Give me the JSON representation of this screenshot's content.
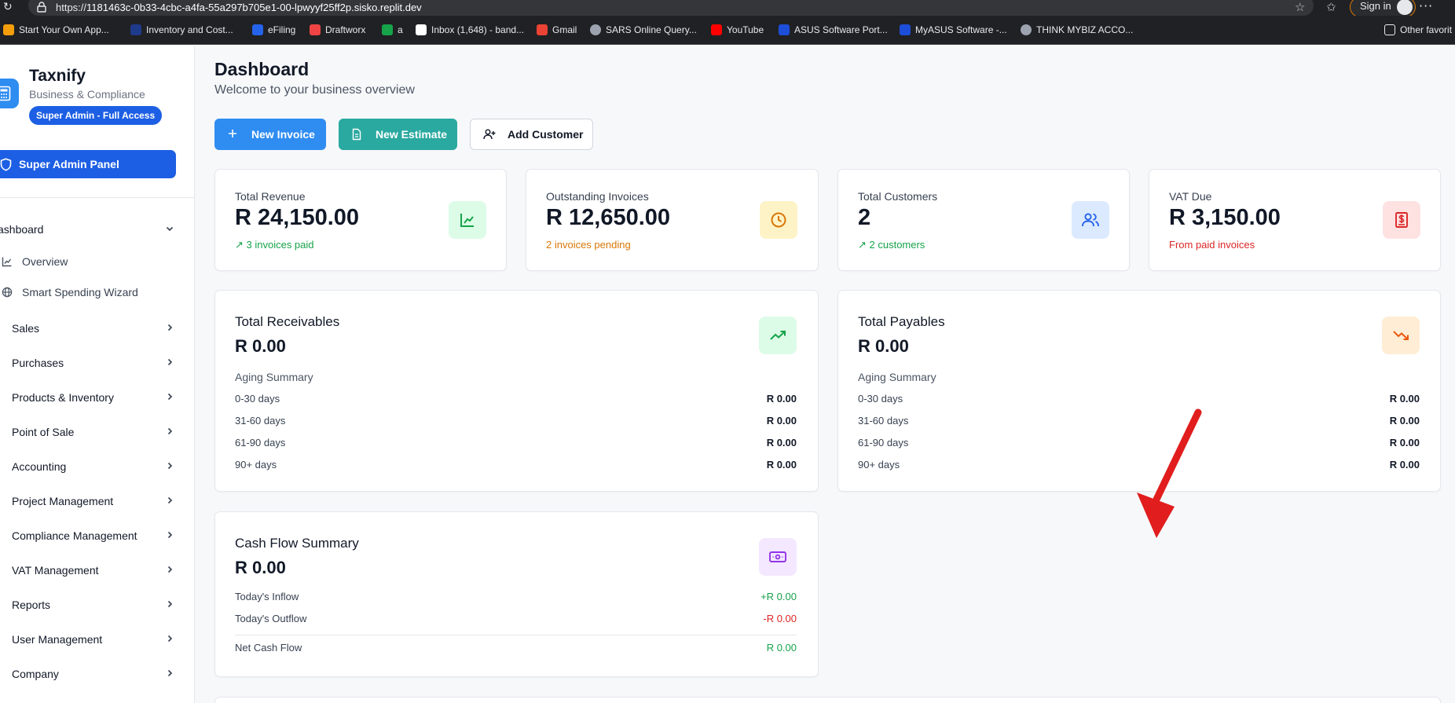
{
  "browser": {
    "url_prefix": "https://",
    "url_host": "1181463c-0b33-4cbc-a4fa-55a297b705e1-00-lpwyyf25ff2p.sisko.replit.dev",
    "signin_label": "Sign in",
    "bookmarks": [
      {
        "label": "Start Your Own App...",
        "color": "#f59e0b"
      },
      {
        "label": "Inventory and Cost...",
        "color": "#1e3a8a"
      },
      {
        "label": "eFiling",
        "color": "#2563eb"
      },
      {
        "label": "Draftworx",
        "color": "#ef4444"
      },
      {
        "label": "a",
        "color": "#16a34a"
      },
      {
        "label": "Inbox (1,648) - band...",
        "color": "#ffffff"
      },
      {
        "label": "Gmail",
        "color": "#ea4335"
      },
      {
        "label": "SARS Online Query...",
        "color": "#9ca3af"
      },
      {
        "label": "YouTube",
        "color": "#ff0000"
      },
      {
        "label": "ASUS Software Port...",
        "color": "#1d4ed8"
      },
      {
        "label": "MyASUS Software -...",
        "color": "#1d4ed8"
      },
      {
        "label": "THINK MYBIZ ACCO...",
        "color": "#9ca3af"
      }
    ],
    "other_favorites": "Other favorit"
  },
  "sidebar": {
    "brand": "Taxnify",
    "brand_sub": "Business & Compliance",
    "role_badge": "Super Admin - Full Access",
    "super_admin_panel": "Super Admin Panel",
    "dashboard_label": "ashboard",
    "sub_items": [
      {
        "label": "Overview",
        "icon": "chart-line-icon"
      },
      {
        "label": "Smart Spending Wizard",
        "icon": "globe-icon"
      }
    ],
    "items": [
      {
        "label": "Sales"
      },
      {
        "label": "Purchases"
      },
      {
        "label": "Products & Inventory"
      },
      {
        "label": "Point of Sale"
      },
      {
        "label": "Accounting"
      },
      {
        "label": "Project Management"
      },
      {
        "label": "Compliance Management"
      },
      {
        "label": "VAT Management"
      },
      {
        "label": "Reports"
      },
      {
        "label": "User Management"
      },
      {
        "label": "Company"
      }
    ]
  },
  "header": {
    "title": "Dashboard",
    "subtitle": "Welcome to your business overview"
  },
  "actions": {
    "new_invoice": "New Invoice",
    "new_estimate": "New Estimate",
    "add_customer": "Add Customer"
  },
  "stats": [
    {
      "label": "Total Revenue",
      "value": "R 24,150.00",
      "note": "↗ 3 invoices paid",
      "note_color": "#16a34a",
      "icon": "chart-line-icon"
    },
    {
      "label": "Outstanding Invoices",
      "value": "R 12,650.00",
      "note": "2 invoices pending",
      "note_color": "#d97706",
      "icon": "clock-icon"
    },
    {
      "label": "Total Customers",
      "value": "2",
      "note": "↗ 2 customers",
      "note_color": "#16a34a",
      "icon": "users-icon"
    },
    {
      "label": "VAT Due",
      "value": "R 3,150.00",
      "note": "From paid invoices",
      "note_color": "#dc2626",
      "icon": "receipt-icon"
    }
  ],
  "receivables": {
    "title": "Total Receivables",
    "amount": "R 0.00",
    "aging_title": "Aging Summary",
    "rows": [
      {
        "k": "0-30 days",
        "v": "R 0.00"
      },
      {
        "k": "31-60 days",
        "v": "R 0.00"
      },
      {
        "k": "61-90 days",
        "v": "R 0.00"
      },
      {
        "k": "90+ days",
        "v": "R 0.00"
      }
    ]
  },
  "payables": {
    "title": "Total Payables",
    "amount": "R 0.00",
    "aging_title": "Aging Summary",
    "rows": [
      {
        "k": "0-30 days",
        "v": "R 0.00"
      },
      {
        "k": "31-60 days",
        "v": "R 0.00"
      },
      {
        "k": "61-90 days",
        "v": "R 0.00"
      },
      {
        "k": "90+ days",
        "v": "R 0.00"
      }
    ]
  },
  "cashflow": {
    "title": "Cash Flow Summary",
    "amount": "R 0.00",
    "inflow_label": "Today's Inflow",
    "inflow_value": "+R 0.00",
    "outflow_label": "Today's Outflow",
    "outflow_value": "-R 0.00",
    "net_label": "Net Cash Flow",
    "net_value": "R 0.00"
  },
  "colors": {
    "primary": "#2f8cf1",
    "teal": "#2aa9a0",
    "admin_blue": "#1d5fe4",
    "annotation_arrow": "#e11d1d"
  }
}
